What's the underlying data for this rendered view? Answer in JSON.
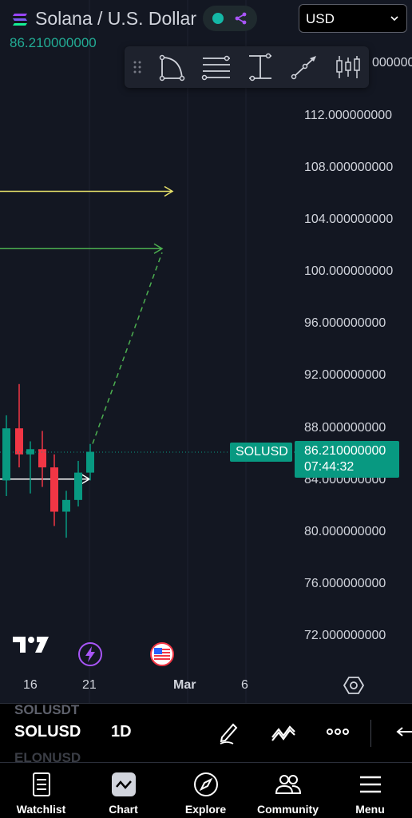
{
  "header": {
    "title": "Solana / U.S. Dollar",
    "last_price": "86.210000000",
    "currency": "USD"
  },
  "toolbar": {
    "items": [
      "curve-tool",
      "fib-retracement-tool",
      "measure-tool",
      "trend-line-tool",
      "indicators-tool"
    ]
  },
  "chart": {
    "price_axis": [
      "000000",
      "112.000000000",
      "108.000000000",
      "104.000000000",
      "100.000000000",
      "96.000000000",
      "92.000000000",
      "88.000000000",
      "84.000000000",
      "80.000000000",
      "76.000000000",
      "72.000000000"
    ],
    "time_axis": [
      "16",
      "21",
      "Mar",
      "6"
    ],
    "current_price": "86.210000000",
    "countdown": "07:44:32",
    "symbol_tag": "SOLUSD",
    "colors": {
      "up": "#089981",
      "down": "#f23645",
      "yellow_line": "#e8e26a",
      "green_line": "#4caf50"
    }
  },
  "chart_data": {
    "type": "candlestick",
    "ylim": [
      70,
      118
    ],
    "candles": [
      {
        "open": 84.0,
        "close": 88.0,
        "high": 89.0,
        "low": 82.8
      },
      {
        "open": 88.0,
        "close": 86.0,
        "high": 91.4,
        "low": 85.0
      },
      {
        "open": 86.0,
        "close": 86.4,
        "high": 87.0,
        "low": 83.0
      },
      {
        "open": 86.4,
        "close": 85.0,
        "high": 87.8,
        "low": 83.5
      },
      {
        "open": 85.0,
        "close": 81.6,
        "high": 86.0,
        "low": 80.5
      },
      {
        "open": 81.6,
        "close": 82.5,
        "high": 83.2,
        "low": 79.6
      },
      {
        "open": 82.5,
        "close": 84.6,
        "high": 85.5,
        "low": 82.0
      },
      {
        "open": 84.6,
        "close": 86.2,
        "high": 86.8,
        "low": 84.0
      }
    ],
    "horizontal_lines": [
      {
        "price": 106.2,
        "color": "#e8e26a"
      },
      {
        "price": 101.8,
        "color": "#4caf50"
      },
      {
        "price": 84.1,
        "color": "#ffffff"
      }
    ],
    "projection": {
      "from": 86.2,
      "to": 101.5
    }
  },
  "symbol_bar": {
    "ghost_top": "SOLUSDT",
    "symbol": "SOLUSD",
    "timeframe": "1D",
    "ghost_bottom": "ELONUSD"
  },
  "nav": {
    "items": [
      {
        "label": "Watchlist",
        "icon": "watchlist-icon"
      },
      {
        "label": "Chart",
        "icon": "chart-icon"
      },
      {
        "label": "Explore",
        "icon": "compass-icon"
      },
      {
        "label": "Community",
        "icon": "community-icon"
      },
      {
        "label": "Menu",
        "icon": "menu-icon"
      }
    ]
  }
}
